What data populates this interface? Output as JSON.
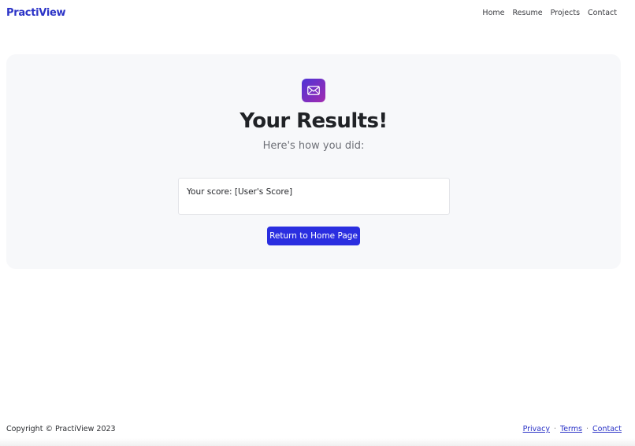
{
  "header": {
    "brand": "PractiView",
    "nav": [
      "Home",
      "Resume",
      "Projects",
      "Contact"
    ]
  },
  "results": {
    "icon": "envelope-icon",
    "title": "Your Results!",
    "subtitle": "Here's how you did:",
    "score_text": "Your score: [User's Score]",
    "button_label": "Return to Home Page"
  },
  "footer": {
    "copyright": "Copyright © PractiView 2023",
    "links": [
      "Privacy",
      "Terms",
      "Contact"
    ],
    "separator": "·"
  },
  "colors": {
    "brand": "#2b33c7",
    "button": "#2a2ee0",
    "card_bg": "#f7f8fa",
    "icon_gradient_start": "#4c34d6",
    "icon_gradient_end": "#a32bb0"
  }
}
